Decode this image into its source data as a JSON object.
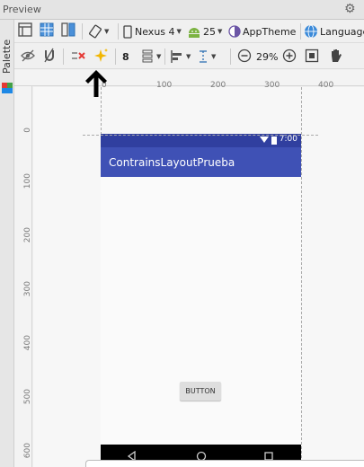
{
  "window": {
    "title": "Preview"
  },
  "palette": {
    "label": "Palette"
  },
  "toolbar1": {
    "device": "Nexus 4",
    "api_level": "25",
    "theme": "AppTheme",
    "language": "Language"
  },
  "toolbar2": {
    "default_margin": "8",
    "zoom": "29%"
  },
  "ruler": {
    "top": [
      "0",
      "100",
      "200",
      "300",
      "400"
    ],
    "left": [
      "0",
      "100",
      "200",
      "300",
      "400",
      "500",
      "600"
    ]
  },
  "device": {
    "status_time": "7:00",
    "app_title": "ContrainsLayoutPrueba",
    "button_label": "BUTTON",
    "status_bar_color": "#303f9f",
    "app_bar_color": "#3f51b5"
  },
  "annotation": {
    "arrow": "black-up-arrow-icon"
  }
}
